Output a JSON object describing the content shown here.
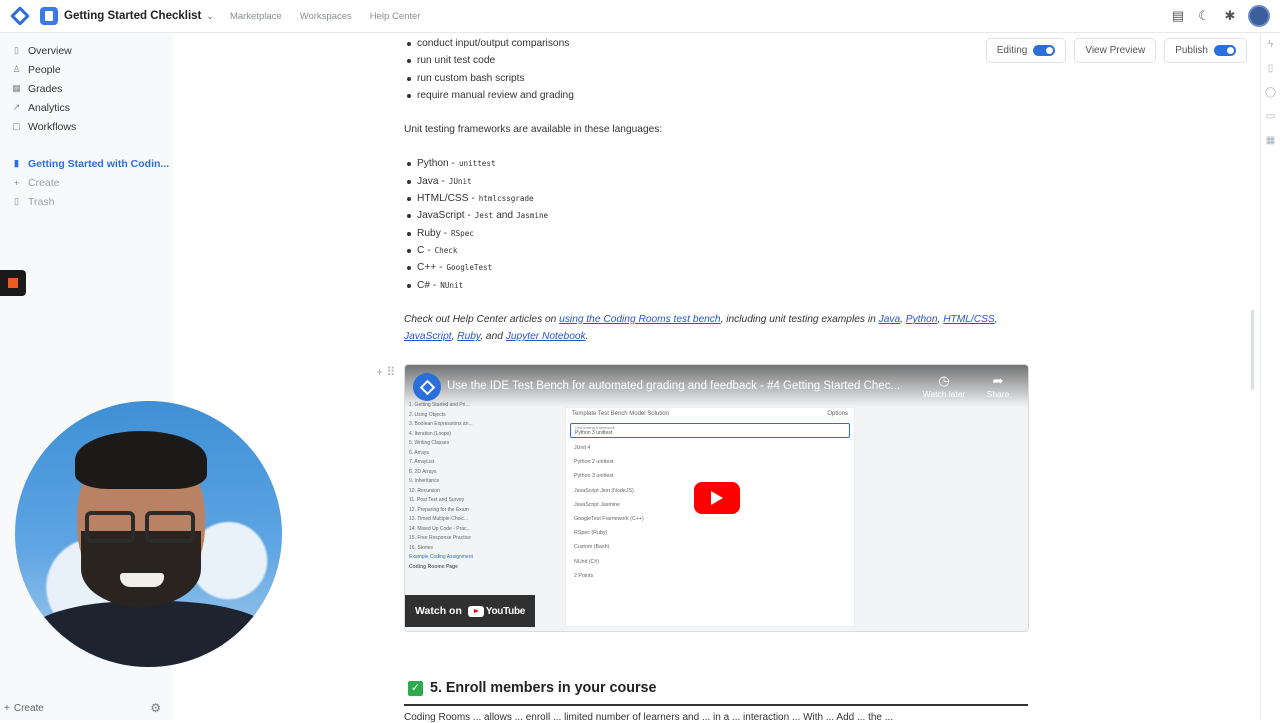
{
  "topbar": {
    "doc_title": "Getting Started Checklist",
    "nav": [
      "Marketplace",
      "Workspaces",
      "Help Center"
    ]
  },
  "sidebar": {
    "items": [
      {
        "label": "Overview",
        "icon": "info-icon"
      },
      {
        "label": "People",
        "icon": "person-icon"
      },
      {
        "label": "Grades",
        "icon": "grades-icon"
      },
      {
        "label": "Analytics",
        "icon": "analytics-icon"
      },
      {
        "label": "Workflows",
        "icon": "workflow-icon"
      }
    ],
    "active_doc": "Getting Started with Codin...",
    "create": "Create",
    "trash": "Trash",
    "bottom_create": "Create"
  },
  "editbar": {
    "editing": "Editing",
    "view_preview": "View Preview",
    "publish": "Publish"
  },
  "content": {
    "bullets_top": [
      "conduct input/output comparisons",
      "run unit test code",
      "run custom bash scripts",
      "require manual review and grading"
    ],
    "frameworks_intro": "Unit testing frameworks are available in these languages:",
    "frameworks": [
      {
        "lang": "Python -",
        "code": [
          "unittest"
        ]
      },
      {
        "lang": "Java -",
        "code": [
          "JUnit"
        ]
      },
      {
        "lang": "HTML/CSS -",
        "code": [
          "htmlcssgrade"
        ]
      },
      {
        "lang": "JavaScript -",
        "code": [
          "Jest",
          "Jasmine"
        ],
        "joiner": "and"
      },
      {
        "lang": "Ruby -",
        "code": [
          "RSpec"
        ]
      },
      {
        "lang": "C -",
        "code": [
          "Check"
        ]
      },
      {
        "lang": "C++ -",
        "code": [
          "GoogleTest"
        ]
      },
      {
        "lang": "C# -",
        "code": [
          "NUnit"
        ]
      }
    ],
    "help": {
      "prefix": "Check out Help Center articles on",
      "link_testbench": "using the Coding Rooms test bench",
      "mid": ", including unit testing examples in",
      "links": [
        "Java",
        "Python",
        "HTML/CSS",
        "JavaScript",
        "Ruby"
      ],
      "and": ", and",
      "last_link": "Jupyter Notebook",
      "end": "."
    }
  },
  "video": {
    "title": "Use the IDE Test Bench for automated grading and feedback - #4 Getting Started Chec...",
    "watch_later": "Watch later",
    "share": "Share",
    "watch_on": "Watch on",
    "youtube": "YouTube",
    "sidebar_items": [
      "1. Getting Started and Pri...",
      "2. Using Objects",
      "3. Boolean Expressions an...",
      "4. Iteration (Loops)",
      "5. Writing Classes",
      "6. Arrays",
      "7. ArrayList",
      "8. 2D Arrays",
      "9. Inheritance",
      "10. Recursion",
      "11. Post Test and Survey",
      "12. Preparing for the Exam",
      "13. Timed Multiple-Choic...",
      "14. Mixed Up Code - Prac...",
      "15. Free Response Practice",
      "16. Stories",
      "Example Coding Assignment",
      "Coding Rooms Page"
    ],
    "panel_tabs": "Template   Test Bench   Model Solution",
    "panel_options": "Options",
    "select_label": "Unit testing framework",
    "select_value": "Python 3 unittest",
    "options": [
      "JUnit 4",
      "Python 2 unittest",
      "Python 3 unittest",
      "JavaScript Jest (NodeJS)",
      "JavaScript Jasmine",
      "GoogleTest Framework (C++)",
      "RSpec (Ruby)",
      "Custom (Bash)",
      "NUnit (C#)"
    ],
    "points": "2 Points"
  },
  "step": {
    "title": "5. Enroll members in your course"
  },
  "next_text": "Coding Rooms ... allows ... enroll ... limited number of learners and ... in a ... interaction ... With ... Add ... the ..."
}
